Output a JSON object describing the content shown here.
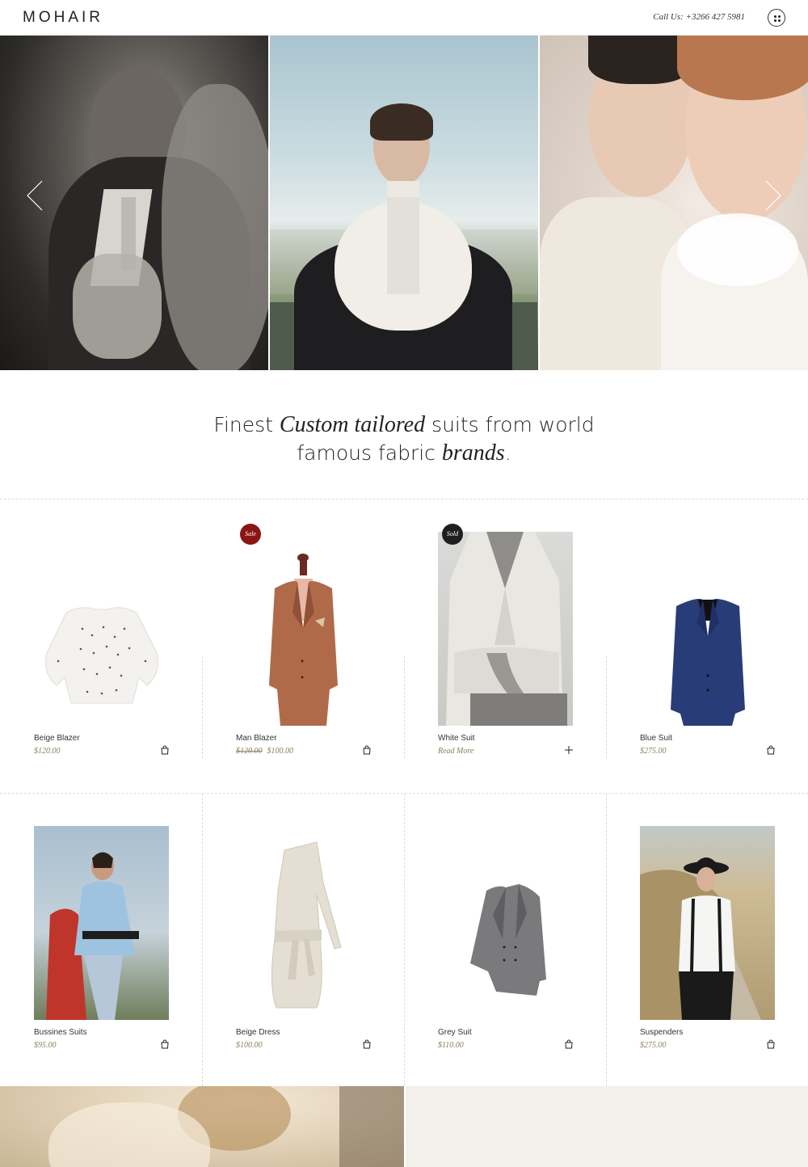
{
  "header": {
    "logo": "MOHAIR",
    "phone": "Call Us: +3266 427 5981"
  },
  "tagline": {
    "part1": "Finest ",
    "em1": "Custom tailored",
    "part2": " suits from world",
    "part3": "famous fabric ",
    "em2": "brands",
    "part4": "."
  },
  "products_row1": [
    {
      "name": "Beige Blazer",
      "price": "$120.00",
      "action": "cart-icon"
    },
    {
      "name": "Man Blazer",
      "old_price": "$120.00",
      "price": "$100.00",
      "badge": "Sale",
      "action": "cart-icon"
    },
    {
      "name": "White Suit",
      "price": "Read More",
      "badge": "Sold",
      "action": "plus-icon"
    },
    {
      "name": "Blue Suit",
      "price": "$275.00",
      "action": "cart-icon"
    }
  ],
  "products_row2": [
    {
      "name": "Bussines Suits",
      "price": "$95.00",
      "action": "cart-icon"
    },
    {
      "name": "Beige Dress",
      "price": "$100.00",
      "action": "cart-icon"
    },
    {
      "name": "Grey Suit",
      "price": "$110.00",
      "action": "cart-icon"
    },
    {
      "name": "Suspenders",
      "price": "$275.00",
      "action": "cart-icon"
    }
  ],
  "colors": {
    "sale_badge": "#8b1414",
    "sold_badge": "#1f1f1f",
    "price": "#8a7f58"
  }
}
